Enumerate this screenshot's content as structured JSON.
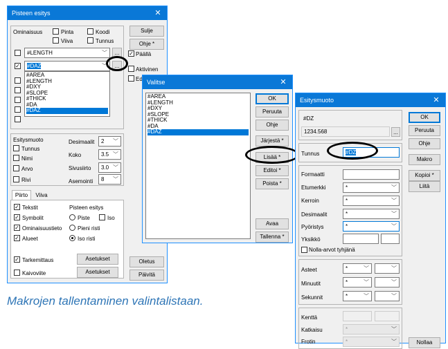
{
  "caption": "Makrojen tallentaminen valintalistaan.",
  "win1": {
    "title": "Pisteen esitys",
    "close": "✕",
    "ominaisuus_label": "Ominaisuus",
    "pinta": "Pinta",
    "koodi": "Koodi",
    "viiva": "Viiva",
    "tunnus": "Tunnus",
    "row1_value": "#LENGTH",
    "row2_value": "#DAZ",
    "ellipsis": "...",
    "dropdown_items": [
      "#AREA",
      "#LENGTH",
      "#DXY",
      "#SLOPE",
      "#THICK",
      "#DA",
      "#DAZ"
    ],
    "selected_item": "#DAZ",
    "btn_sulje": "Sulje",
    "btn_ohje": "Ohje *",
    "paalla": "Päällä",
    "aktivinen": "Aktivinen",
    "edi": "Edi",
    "esitysmuoto_label": "Esitysmuoto",
    "tunnus2": "Tunnus",
    "nimi": "Nimi",
    "arvo": "Arvo",
    "rivi": "Rivi",
    "desimaalit": "Desimaalit",
    "desimaalit_val": "2",
    "koko": "Koko",
    "koko_val": "3.5",
    "sivusiirto": "Sivusiirto",
    "sivusiirto_val": "3.0",
    "asemointi": "Asemointi",
    "asemointi_val": "8",
    "tab_piirto": "Piirto",
    "tab_viiva": "Viiva",
    "tekstit": "Tekstit",
    "symbolit": "Symbolit",
    "ominaisuustieto": "Ominaisuustieto",
    "alueet": "Alueet",
    "pisteen_esitys": "Pisteen esitys",
    "piste": "Piste",
    "iso": "Iso",
    "pieni_risti": "Pieni risti",
    "iso_risti": "Iso risti",
    "tarkemittaus": "Tarkemittaus",
    "kaivoviite": "Kaivoviite",
    "asetukset": "Asetukset",
    "oletus": "Oletus",
    "paivita": "Päivitä"
  },
  "win2": {
    "title": "Valitse",
    "close": "✕",
    "items": [
      "#AREA",
      "#LENGTH",
      "#DXY",
      "#SLOPE",
      "#THICK",
      "#DA",
      "#DAZ"
    ],
    "selected": "#DAZ",
    "ok": "OK",
    "peruuta": "Peruuta",
    "ohje": "Ohje",
    "jarjesta": "Järjestä *",
    "lisaa": "Lisää *",
    "editoi": "Editoi *",
    "poista": "Poista *",
    "avaa": "Avaa",
    "tallenna": "Tallenna *"
  },
  "win3": {
    "title": "Esitysmuoto",
    "close": "✕",
    "preview_name": "#DZ",
    "preview_value": "1234.568",
    "ellipsis": "...",
    "tunnus_label": "Tunnus",
    "tunnus_value": "#DZ",
    "ok": "OK",
    "peruuta": "Peruuta",
    "ohje": "Ohje",
    "makro": "Makro",
    "kopioi": "Kopioi *",
    "liita": "Liitä",
    "formaatti": "Formaatti",
    "etumerkki": "Etumerkki",
    "kerroin": "Kerroin",
    "desimaalit": "Desimaalit",
    "pyoristys": "Pyöristys",
    "yksikko": "Yksikkö",
    "nolla": "Nolla-arvot tyhjänä",
    "star": "*",
    "asteet": "Asteet",
    "minuutit": "Minuutit",
    "sekunnit": "Sekunnit",
    "kentta": "Kenttä",
    "katkaisu": "Katkaisu",
    "frotin": "Frotin",
    "nollaa": "Nollaa"
  }
}
